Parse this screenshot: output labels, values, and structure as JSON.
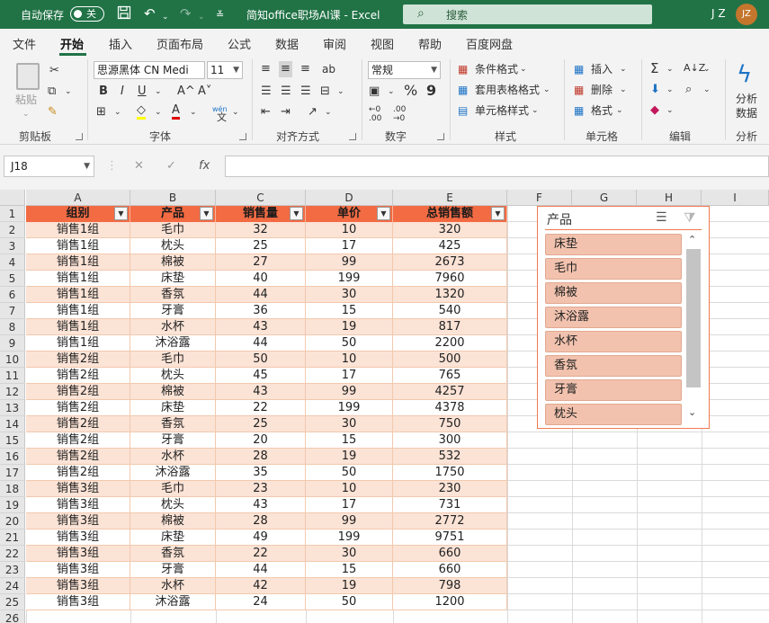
{
  "titlebar": {
    "autosave_label": "自动保存",
    "autosave_state": "关",
    "doc_title": "简知office职场AI课  -  Excel",
    "search_placeholder": "搜索",
    "user_initials": "J Z",
    "avatar_text": "JZ"
  },
  "menu": {
    "items": [
      "文件",
      "开始",
      "插入",
      "页面布局",
      "公式",
      "数据",
      "审阅",
      "视图",
      "帮助",
      "百度网盘"
    ],
    "active_index": 1
  },
  "ribbon": {
    "clipboard": {
      "paste": "粘贴",
      "group": "剪贴板"
    },
    "font": {
      "name": "思源黑体 CN Medi",
      "size": "11",
      "bold": "B",
      "italic": "I",
      "underline": "U",
      "grow": "A^",
      "shrink": "A˅",
      "wen": "wén",
      "group": "字体"
    },
    "align": {
      "group": "对齐方式"
    },
    "number": {
      "format": "常规",
      "percent": "%",
      "comma": "9",
      "group": "数字"
    },
    "styles": {
      "cond": "条件格式",
      "table": "套用表格格式",
      "cell": "单元格样式",
      "group": "样式"
    },
    "cells": {
      "insert": "插入",
      "delete": "删除",
      "format": "格式",
      "group": "单元格"
    },
    "editing": {
      "group": "编辑"
    },
    "analysis": {
      "line1": "分析",
      "line2": "数据",
      "group": "分析"
    }
  },
  "formula_bar": {
    "name_box": "J18",
    "cancel": "✕",
    "enter": "✓",
    "fx": "fx",
    "content": ""
  },
  "columns": [
    "A",
    "B",
    "C",
    "D",
    "E",
    "F",
    "G",
    "H",
    "I"
  ],
  "row_numbers": [
    "1",
    "2",
    "3",
    "4",
    "5",
    "6",
    "7",
    "8",
    "9",
    "10",
    "11",
    "12",
    "13",
    "14",
    "15",
    "16",
    "17",
    "18",
    "19",
    "20",
    "21",
    "22",
    "23",
    "24",
    "25",
    "26"
  ],
  "table": {
    "headers": [
      "组别",
      "产品",
      "销售量",
      "单价",
      "总销售额"
    ],
    "rows": [
      [
        "销售1组",
        "毛巾",
        "32",
        "10",
        "320"
      ],
      [
        "销售1组",
        "枕头",
        "25",
        "17",
        "425"
      ],
      [
        "销售1组",
        "棉被",
        "27",
        "99",
        "2673"
      ],
      [
        "销售1组",
        "床垫",
        "40",
        "199",
        "7960"
      ],
      [
        "销售1组",
        "香氛",
        "44",
        "30",
        "1320"
      ],
      [
        "销售1组",
        "牙膏",
        "36",
        "15",
        "540"
      ],
      [
        "销售1组",
        "水杯",
        "43",
        "19",
        "817"
      ],
      [
        "销售1组",
        "沐浴露",
        "44",
        "50",
        "2200"
      ],
      [
        "销售2组",
        "毛巾",
        "50",
        "10",
        "500"
      ],
      [
        "销售2组",
        "枕头",
        "45",
        "17",
        "765"
      ],
      [
        "销售2组",
        "棉被",
        "43",
        "99",
        "4257"
      ],
      [
        "销售2组",
        "床垫",
        "22",
        "199",
        "4378"
      ],
      [
        "销售2组",
        "香氛",
        "25",
        "30",
        "750"
      ],
      [
        "销售2组",
        "牙膏",
        "20",
        "15",
        "300"
      ],
      [
        "销售2组",
        "水杯",
        "28",
        "19",
        "532"
      ],
      [
        "销售2组",
        "沐浴露",
        "35",
        "50",
        "1750"
      ],
      [
        "销售3组",
        "毛巾",
        "23",
        "10",
        "230"
      ],
      [
        "销售3组",
        "枕头",
        "43",
        "17",
        "731"
      ],
      [
        "销售3组",
        "棉被",
        "28",
        "99",
        "2772"
      ],
      [
        "销售3组",
        "床垫",
        "49",
        "199",
        "9751"
      ],
      [
        "销售3组",
        "香氛",
        "22",
        "30",
        "660"
      ],
      [
        "销售3组",
        "牙膏",
        "44",
        "15",
        "660"
      ],
      [
        "销售3组",
        "水杯",
        "42",
        "19",
        "798"
      ],
      [
        "销售3组",
        "沐浴露",
        "24",
        "50",
        "1200"
      ]
    ]
  },
  "slicer": {
    "title": "产品",
    "items": [
      "床垫",
      "毛巾",
      "棉被",
      "沐浴露",
      "水杯",
      "香氛",
      "牙膏",
      "枕头"
    ]
  },
  "colors": {
    "excel_green": "#217346",
    "header_fill": "#f26b43",
    "band_fill": "#fbe3d6",
    "slicer_item": "#f2c2ae",
    "slicer_border": "#f07a52"
  }
}
